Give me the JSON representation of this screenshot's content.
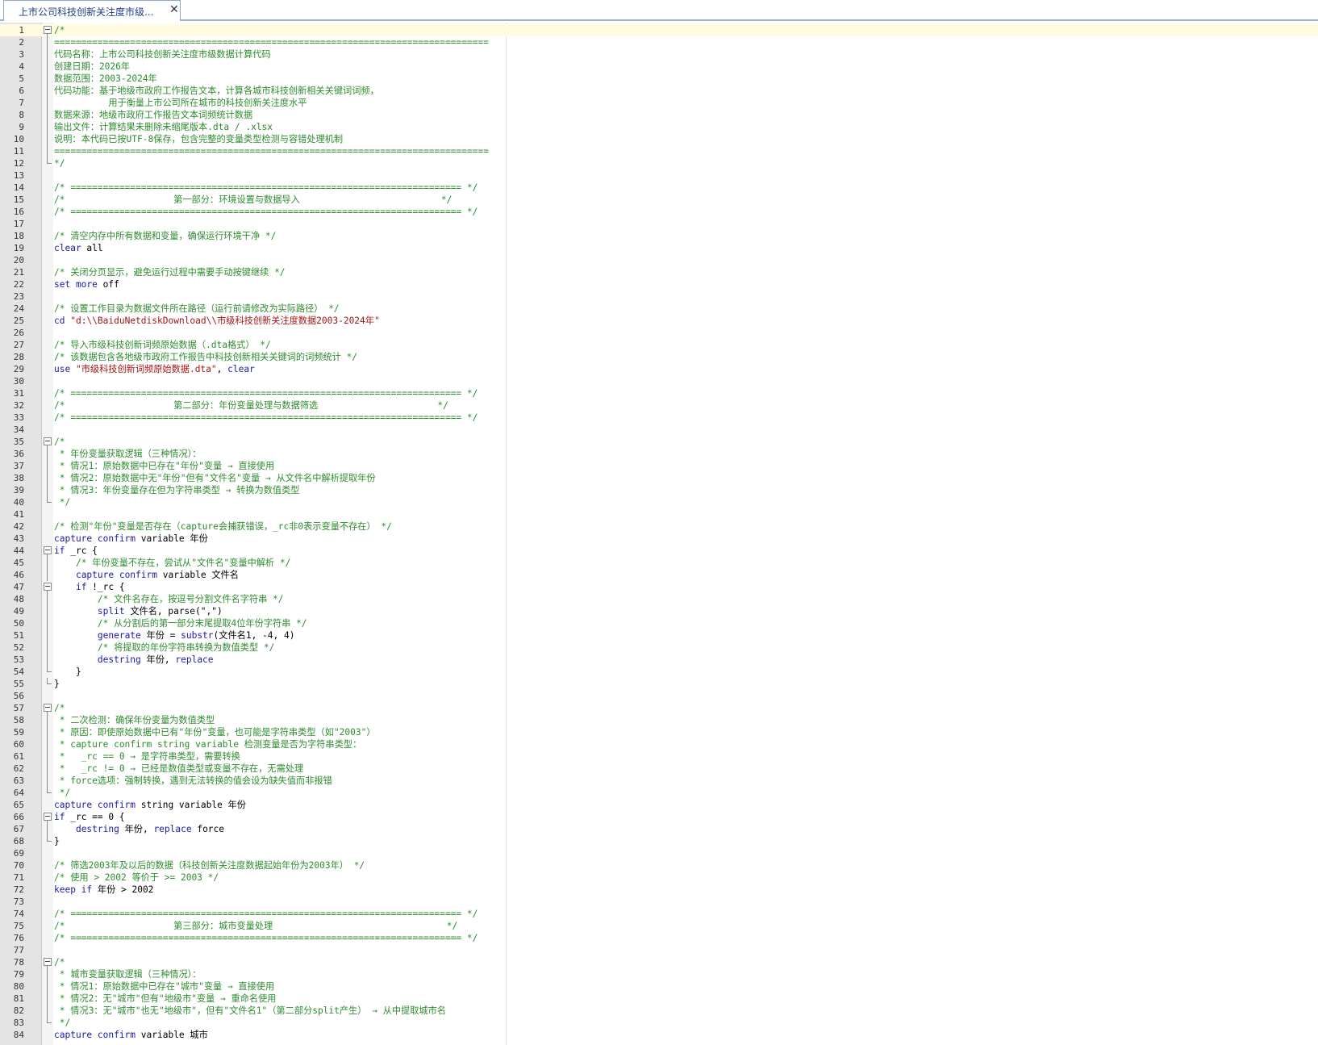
{
  "tab": {
    "title": "上市公司科技创新关注度市级...",
    "close_icon": "close-icon"
  },
  "colors": {
    "comment": "#2e8b2e",
    "keyword": "#1a1aa6",
    "string": "#a31515",
    "current_line": "#fffbe0"
  },
  "lines": [
    {
      "n": "1",
      "fold": "start",
      "parts": [
        [
          "c",
          "/*"
        ]
      ]
    },
    {
      "n": "2",
      "fold": "mid",
      "parts": [
        [
          "c",
          "================================================================================"
        ]
      ]
    },
    {
      "n": "3",
      "fold": "mid",
      "parts": [
        [
          "c",
          "代码名称：上市公司科技创新关注度市级数据计算代码"
        ]
      ]
    },
    {
      "n": "4",
      "fold": "mid",
      "parts": [
        [
          "c",
          "创建日期：2026年"
        ]
      ]
    },
    {
      "n": "5",
      "fold": "mid",
      "parts": [
        [
          "c",
          "数据范围：2003-2024年"
        ]
      ]
    },
    {
      "n": "6",
      "fold": "mid",
      "parts": [
        [
          "c",
          "代码功能：基于地级市政府工作报告文本，计算各城市科技创新相关关键词词频，"
        ]
      ]
    },
    {
      "n": "7",
      "fold": "mid",
      "parts": [
        [
          "c",
          "          用于衡量上市公司所在城市的科技创新关注度水平"
        ]
      ]
    },
    {
      "n": "8",
      "fold": "mid",
      "parts": [
        [
          "c",
          "数据来源：地级市政府工作报告文本词频统计数据"
        ]
      ]
    },
    {
      "n": "9",
      "fold": "mid",
      "parts": [
        [
          "c",
          "输出文件：计算结果未删除未缩尾版本.dta / .xlsx"
        ]
      ]
    },
    {
      "n": "10",
      "fold": "mid",
      "parts": [
        [
          "c",
          "说明：本代码已按UTF-8保存，包含完整的变量类型检测与容错处理机制"
        ]
      ]
    },
    {
      "n": "11",
      "fold": "mid",
      "parts": [
        [
          "c",
          "================================================================================"
        ]
      ]
    },
    {
      "n": "12",
      "fold": "end",
      "parts": [
        [
          "c",
          "*/"
        ]
      ]
    },
    {
      "n": "13",
      "fold": "",
      "parts": []
    },
    {
      "n": "14",
      "fold": "",
      "parts": [
        [
          "c",
          "/* ======================================================================== */"
        ]
      ]
    },
    {
      "n": "15",
      "fold": "",
      "parts": [
        [
          "c",
          "/*                    第一部分：环境设置与数据导入                          */"
        ]
      ]
    },
    {
      "n": "16",
      "fold": "",
      "parts": [
        [
          "c",
          "/* ======================================================================== */"
        ]
      ]
    },
    {
      "n": "17",
      "fold": "",
      "parts": []
    },
    {
      "n": "18",
      "fold": "",
      "parts": [
        [
          "c",
          "/* 清空内存中所有数据和变量，确保运行环境干净 */"
        ]
      ]
    },
    {
      "n": "19",
      "fold": "",
      "parts": [
        [
          "k",
          "clear"
        ],
        [
          "p",
          " all"
        ]
      ]
    },
    {
      "n": "20",
      "fold": "",
      "parts": []
    },
    {
      "n": "21",
      "fold": "",
      "parts": [
        [
          "c",
          "/* 关闭分页显示，避免运行过程中需要手动按键继续 */"
        ]
      ]
    },
    {
      "n": "22",
      "fold": "",
      "parts": [
        [
          "k",
          "set more"
        ],
        [
          "p",
          " off"
        ]
      ]
    },
    {
      "n": "23",
      "fold": "",
      "parts": []
    },
    {
      "n": "24",
      "fold": "",
      "parts": [
        [
          "c",
          "/* 设置工作目录为数据文件所在路径（运行前请修改为实际路径） */"
        ]
      ]
    },
    {
      "n": "25",
      "fold": "",
      "parts": [
        [
          "k",
          "cd"
        ],
        [
          "p",
          " "
        ],
        [
          "s",
          "\"d:\\\\BaiduNetdiskDownload\\\\市级科技创新关注度数据2003-2024年\""
        ]
      ]
    },
    {
      "n": "26",
      "fold": "",
      "parts": []
    },
    {
      "n": "27",
      "fold": "",
      "parts": [
        [
          "c",
          "/* 导入市级科技创新词频原始数据（.dta格式） */"
        ]
      ]
    },
    {
      "n": "28",
      "fold": "",
      "parts": [
        [
          "c",
          "/* 该数据包含各地级市政府工作报告中科技创新相关关键词的词频统计 */"
        ]
      ]
    },
    {
      "n": "29",
      "fold": "",
      "parts": [
        [
          "k",
          "use"
        ],
        [
          "p",
          " "
        ],
        [
          "s",
          "\"市级科技创新词频原始数据.dta\""
        ],
        [
          "p",
          ", "
        ],
        [
          "k",
          "clear"
        ]
      ]
    },
    {
      "n": "30",
      "fold": "",
      "parts": []
    },
    {
      "n": "31",
      "fold": "",
      "parts": [
        [
          "c",
          "/* ======================================================================== */"
        ]
      ]
    },
    {
      "n": "32",
      "fold": "",
      "parts": [
        [
          "c",
          "/*                    第二部分：年份变量处理与数据筛选                      */"
        ]
      ]
    },
    {
      "n": "33",
      "fold": "",
      "parts": [
        [
          "c",
          "/* ======================================================================== */"
        ]
      ]
    },
    {
      "n": "34",
      "fold": "",
      "parts": []
    },
    {
      "n": "35",
      "fold": "start",
      "parts": [
        [
          "c",
          "/*"
        ]
      ]
    },
    {
      "n": "36",
      "fold": "mid",
      "parts": [
        [
          "c",
          " * 年份变量获取逻辑（三种情况）："
        ]
      ]
    },
    {
      "n": "37",
      "fold": "mid",
      "parts": [
        [
          "c",
          " * 情况1：原始数据中已存在\"年份\"变量 → 直接使用"
        ]
      ]
    },
    {
      "n": "38",
      "fold": "mid",
      "parts": [
        [
          "c",
          " * 情况2：原始数据中无\"年份\"但有\"文件名\"变量 → 从文件名中解析提取年份"
        ]
      ]
    },
    {
      "n": "39",
      "fold": "mid",
      "parts": [
        [
          "c",
          " * 情况3：年份变量存在但为字符串类型 → 转换为数值类型"
        ]
      ]
    },
    {
      "n": "40",
      "fold": "end",
      "parts": [
        [
          "c",
          " */"
        ]
      ]
    },
    {
      "n": "41",
      "fold": "",
      "parts": []
    },
    {
      "n": "42",
      "fold": "",
      "parts": [
        [
          "c",
          "/* 检测\"年份\"变量是否存在（capture会捕获错误，_rc非0表示变量不存在） */"
        ]
      ]
    },
    {
      "n": "43",
      "fold": "",
      "parts": [
        [
          "k",
          "capture confirm"
        ],
        [
          "p",
          " variable 年份"
        ]
      ]
    },
    {
      "n": "44",
      "fold": "start",
      "parts": [
        [
          "k",
          "if"
        ],
        [
          "p",
          " _rc {"
        ]
      ]
    },
    {
      "n": "45",
      "fold": "mid",
      "parts": [
        [
          "p",
          "    "
        ],
        [
          "c",
          "/* 年份变量不存在，尝试从\"文件名\"变量中解析 */"
        ]
      ]
    },
    {
      "n": "46",
      "fold": "mid",
      "parts": [
        [
          "p",
          "    "
        ],
        [
          "k",
          "capture confirm"
        ],
        [
          "p",
          " variable 文件名"
        ]
      ]
    },
    {
      "n": "47",
      "fold": "start",
      "parts": [
        [
          "p",
          "    "
        ],
        [
          "k",
          "if"
        ],
        [
          "p",
          " !_rc {"
        ]
      ]
    },
    {
      "n": "48",
      "fold": "mid",
      "parts": [
        [
          "p",
          "        "
        ],
        [
          "c",
          "/* 文件名存在，按逗号分割文件名字符串 */"
        ]
      ]
    },
    {
      "n": "49",
      "fold": "mid",
      "parts": [
        [
          "p",
          "        "
        ],
        [
          "k",
          "split"
        ],
        [
          "p",
          " 文件名, parse(\",\")"
        ]
      ]
    },
    {
      "n": "50",
      "fold": "mid",
      "parts": [
        [
          "p",
          "        "
        ],
        [
          "c",
          "/* 从分割后的第一部分末尾提取4位年份字符串 */"
        ]
      ]
    },
    {
      "n": "51",
      "fold": "mid",
      "parts": [
        [
          "p",
          "        "
        ],
        [
          "k",
          "generate"
        ],
        [
          "p",
          " 年份 = "
        ],
        [
          "k",
          "substr"
        ],
        [
          "p",
          "(文件名1, -4, 4)"
        ]
      ]
    },
    {
      "n": "52",
      "fold": "mid",
      "parts": [
        [
          "p",
          "        "
        ],
        [
          "c",
          "/* 将提取的年份字符串转换为数值类型 */"
        ]
      ]
    },
    {
      "n": "53",
      "fold": "mid",
      "parts": [
        [
          "p",
          "        "
        ],
        [
          "k",
          "destring"
        ],
        [
          "p",
          " 年份, "
        ],
        [
          "k",
          "replace"
        ]
      ]
    },
    {
      "n": "54",
      "fold": "end",
      "parts": [
        [
          "p",
          "    }"
        ]
      ]
    },
    {
      "n": "55",
      "fold": "end",
      "parts": [
        [
          "p",
          "}"
        ]
      ]
    },
    {
      "n": "56",
      "fold": "",
      "parts": []
    },
    {
      "n": "57",
      "fold": "start",
      "parts": [
        [
          "c",
          "/*"
        ]
      ]
    },
    {
      "n": "58",
      "fold": "mid",
      "parts": [
        [
          "c",
          " * 二次检测：确保年份变量为数值类型"
        ]
      ]
    },
    {
      "n": "59",
      "fold": "mid",
      "parts": [
        [
          "c",
          " * 原因：即使原始数据中已有\"年份\"变量，也可能是字符串类型（如\"2003\"）"
        ]
      ]
    },
    {
      "n": "60",
      "fold": "mid",
      "parts": [
        [
          "c",
          " * capture confirm string variable 检测变量是否为字符串类型："
        ]
      ]
    },
    {
      "n": "61",
      "fold": "mid",
      "parts": [
        [
          "c",
          " *   _rc == 0 → 是字符串类型，需要转换"
        ]
      ]
    },
    {
      "n": "62",
      "fold": "mid",
      "parts": [
        [
          "c",
          " *   _rc != 0 → 已经是数值类型或变量不存在，无需处理"
        ]
      ]
    },
    {
      "n": "63",
      "fold": "mid",
      "parts": [
        [
          "c",
          " * force选项：强制转换，遇到无法转换的值会设为缺失值而非报错"
        ]
      ]
    },
    {
      "n": "64",
      "fold": "end",
      "parts": [
        [
          "c",
          " */"
        ]
      ]
    },
    {
      "n": "65",
      "fold": "",
      "parts": [
        [
          "k",
          "capture confirm"
        ],
        [
          "p",
          " string variable 年份"
        ]
      ]
    },
    {
      "n": "66",
      "fold": "start",
      "parts": [
        [
          "k",
          "if"
        ],
        [
          "p",
          " _rc == 0 {"
        ]
      ]
    },
    {
      "n": "67",
      "fold": "mid",
      "parts": [
        [
          "p",
          "    "
        ],
        [
          "k",
          "destring"
        ],
        [
          "p",
          " 年份, "
        ],
        [
          "k",
          "replace"
        ],
        [
          "p",
          " force"
        ]
      ]
    },
    {
      "n": "68",
      "fold": "end",
      "parts": [
        [
          "p",
          "}"
        ]
      ]
    },
    {
      "n": "69",
      "fold": "",
      "parts": []
    },
    {
      "n": "70",
      "fold": "",
      "parts": [
        [
          "c",
          "/* 筛选2003年及以后的数据（科技创新关注度数据起始年份为2003年） */"
        ]
      ]
    },
    {
      "n": "71",
      "fold": "",
      "parts": [
        [
          "c",
          "/* 使用 > 2002 等价于 >= 2003 */"
        ]
      ]
    },
    {
      "n": "72",
      "fold": "",
      "parts": [
        [
          "k",
          "keep if"
        ],
        [
          "p",
          " 年份 > 2002"
        ]
      ]
    },
    {
      "n": "73",
      "fold": "",
      "parts": []
    },
    {
      "n": "74",
      "fold": "",
      "parts": [
        [
          "c",
          "/* ======================================================================== */"
        ]
      ]
    },
    {
      "n": "75",
      "fold": "",
      "parts": [
        [
          "c",
          "/*                    第三部分：城市变量处理                                */"
        ]
      ]
    },
    {
      "n": "76",
      "fold": "",
      "parts": [
        [
          "c",
          "/* ======================================================================== */"
        ]
      ]
    },
    {
      "n": "77",
      "fold": "",
      "parts": []
    },
    {
      "n": "78",
      "fold": "start",
      "parts": [
        [
          "c",
          "/*"
        ]
      ]
    },
    {
      "n": "79",
      "fold": "mid",
      "parts": [
        [
          "c",
          " * 城市变量获取逻辑（三种情况）："
        ]
      ]
    },
    {
      "n": "80",
      "fold": "mid",
      "parts": [
        [
          "c",
          " * 情况1：原始数据中已存在\"城市\"变量 → 直接使用"
        ]
      ]
    },
    {
      "n": "81",
      "fold": "mid",
      "parts": [
        [
          "c",
          " * 情况2：无\"城市\"但有\"地级市\"变量 → 重命名使用"
        ]
      ]
    },
    {
      "n": "82",
      "fold": "mid",
      "parts": [
        [
          "c",
          " * 情况3：无\"城市\"也无\"地级市\"，但有\"文件名1\"（第二部分split产生） → 从中提取城市名"
        ]
      ]
    },
    {
      "n": "83",
      "fold": "end",
      "parts": [
        [
          "c",
          " */"
        ]
      ]
    },
    {
      "n": "84",
      "fold": "",
      "parts": [
        [
          "k",
          "capture confirm"
        ],
        [
          "p",
          " variable 城市"
        ]
      ]
    }
  ]
}
